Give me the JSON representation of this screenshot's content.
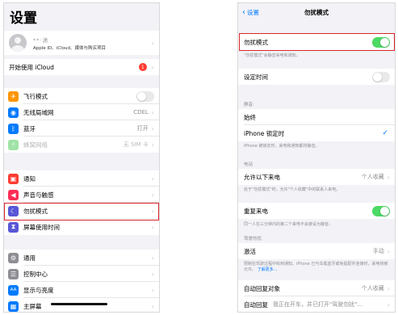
{
  "left": {
    "title": "设置",
    "profile": {
      "name": "**·潇",
      "subtitle": "Apple ID、iCloud、媒体与购买项目"
    },
    "icloud_row": {
      "label": "开始使用 iCloud",
      "badge": "1"
    },
    "group1": [
      {
        "label": "飞行模式",
        "icon": "airplane-icon",
        "color": "#ff9500",
        "glyph": "✈"
      },
      {
        "label": "无线局域网",
        "icon": "wifi-icon",
        "color": "#007aff",
        "glyph": "◉",
        "value": "CDEL"
      },
      {
        "label": "蓝牙",
        "icon": "bluetooth-icon",
        "color": "#007aff",
        "glyph": "ᛒ",
        "value": "打开"
      },
      {
        "label": "蜂窝网络",
        "icon": "cellular-icon",
        "color": "#9fe3a6",
        "glyph": "ıl",
        "value": "无 SIM 卡"
      }
    ],
    "group2": [
      {
        "label": "通知",
        "icon": "notifications-icon",
        "color": "#ff3b30",
        "glyph": "▣"
      },
      {
        "label": "声音与触感",
        "icon": "sound-icon",
        "color": "#ff2d55",
        "glyph": "◀"
      },
      {
        "label": "勿扰模式",
        "icon": "moon-icon",
        "color": "#5856d6",
        "glyph": "☾"
      },
      {
        "label": "屏幕使用时间",
        "icon": "hourglass-icon",
        "color": "#5856d6",
        "glyph": "⧗"
      }
    ],
    "group3": [
      {
        "label": "通用",
        "icon": "gear-icon",
        "color": "#8e8e93",
        "glyph": "⚙"
      },
      {
        "label": "控制中心",
        "icon": "control-center-icon",
        "color": "#8e8e93",
        "glyph": "☰"
      },
      {
        "label": "显示与亮度",
        "icon": "display-icon",
        "color": "#007aff",
        "glyph": "AA"
      },
      {
        "label": "主屏幕",
        "icon": "home-screen-icon",
        "color": "#007aff",
        "glyph": "▦"
      }
    ]
  },
  "right": {
    "back": "设置",
    "title": "勿扰模式",
    "dnd": {
      "label": "勿扰模式",
      "on": 1
    },
    "dnd_note": "\"勿扰模式\"会静音来电和通知。",
    "scheduled": {
      "label": "设定时间",
      "on": 0
    },
    "silence_header": "静音:",
    "always": {
      "label": "始终"
    },
    "locked": {
      "label": "iPhone 锁定时",
      "check": "✓"
    },
    "locked_note": "iPhone 被锁定时，来电和通知都将静音。",
    "phone_header": "电话",
    "allow_calls": {
      "label": "允许以下来电",
      "value": "个人收藏"
    },
    "allow_note": "处于\"勿扰模式\"时，允许\"个人收藏\"中的联系人来电。",
    "repeated": {
      "label": "重复来电",
      "on": 1
    },
    "repeated_note": "同一人在三分钟内的第二个来电不会被设为静音。",
    "driving_header": "驾驶勿扰",
    "activate": {
      "label": "激活",
      "value": "手动"
    },
    "activate_note": "限制在驾驶过程中收到通知。iPhone 已与车载蓝牙或免提配件连接时，来电将被允许。",
    "activate_link": "了解更多...",
    "autoreply_to": {
      "label": "自动回复对象",
      "value": "个人收藏"
    },
    "autoreply": {
      "label": "自动回复",
      "value": "我正在开车，并已打开\"驾驶勿扰\"..."
    }
  },
  "colors": {
    "toggle_on": "#4cd964",
    "highlight": "#d9262b",
    "link": "#007aff"
  }
}
